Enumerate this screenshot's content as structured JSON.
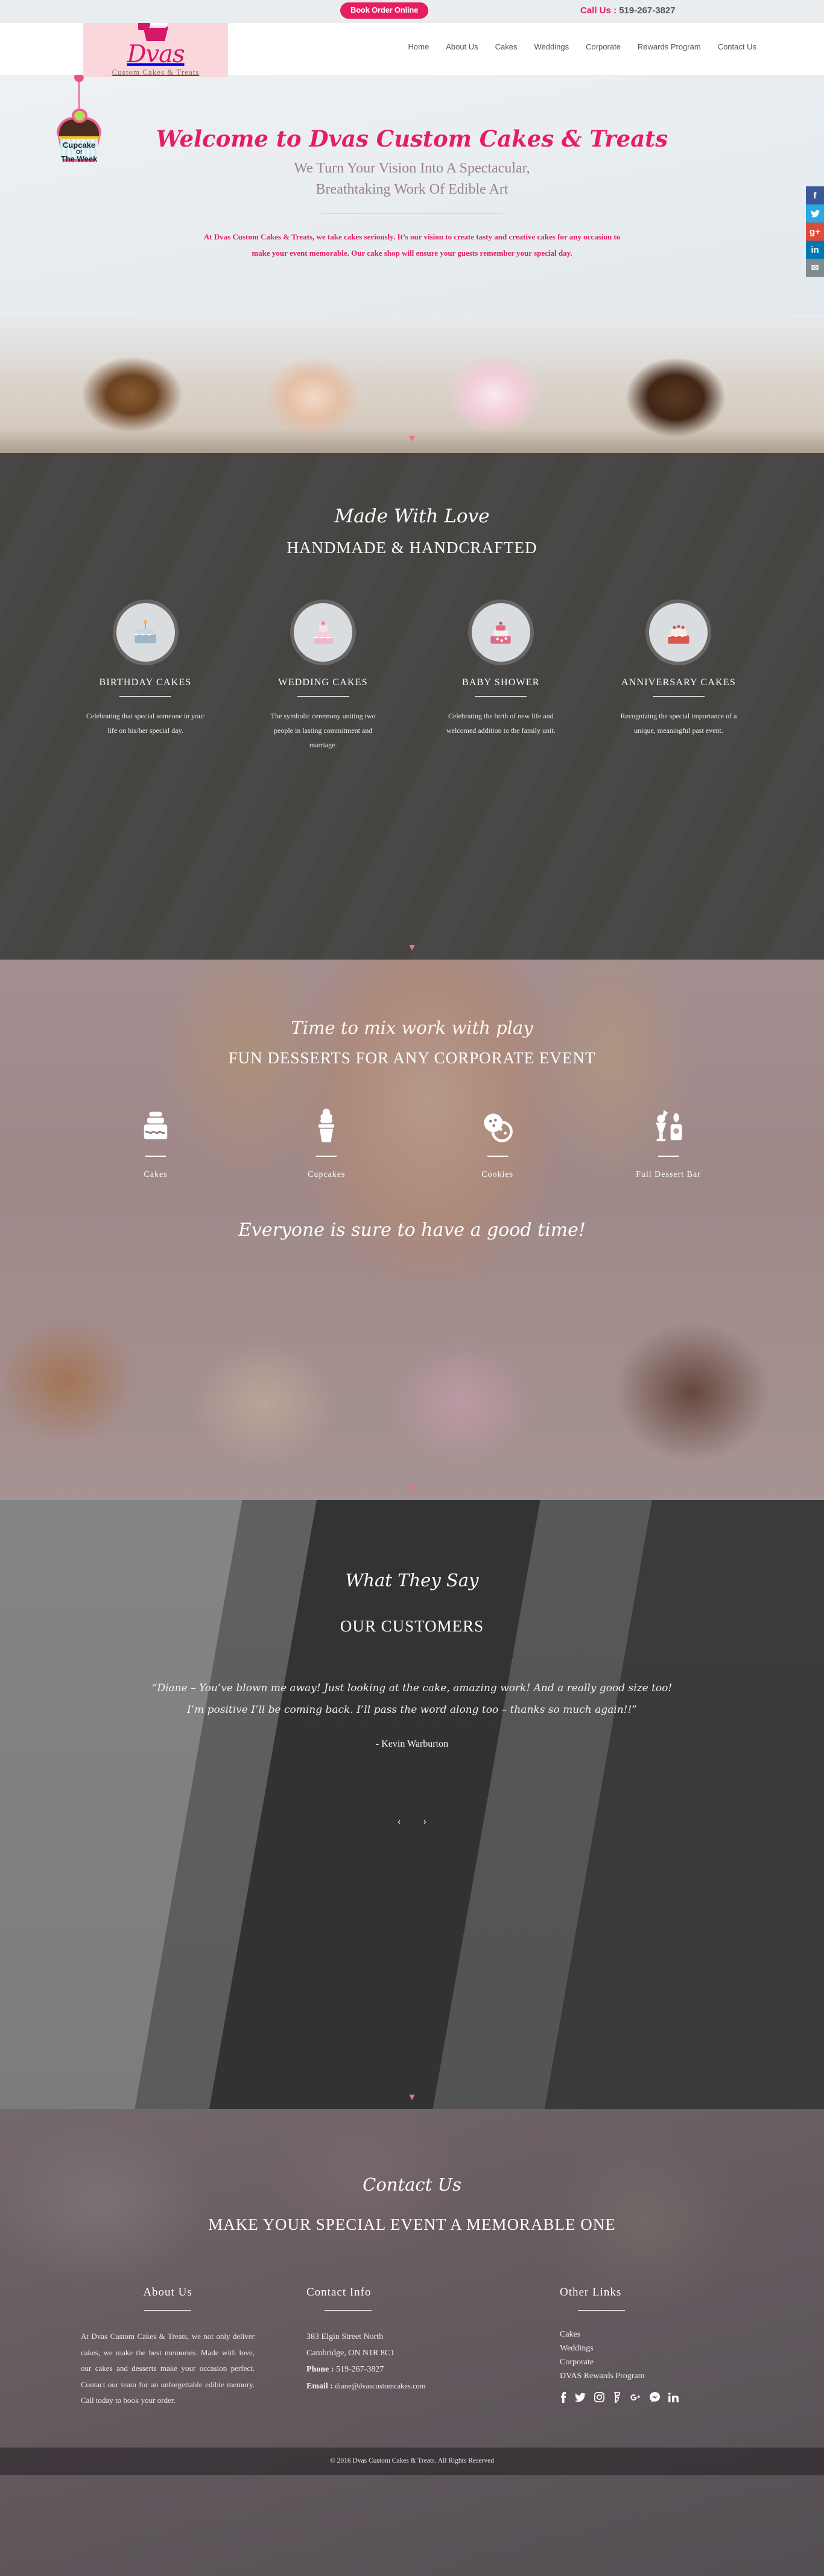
{
  "topbar": {
    "book_button": "Book Order Online",
    "call_label": "Call Us :",
    "phone": "519-267-3827"
  },
  "header": {
    "logo_name": "Dvas",
    "logo_sub": "Custom Cakes & Treats",
    "nav": [
      {
        "label": "Home"
      },
      {
        "label": "About Us"
      },
      {
        "label": "Cakes"
      },
      {
        "label": "Weddings"
      },
      {
        "label": "Corporate"
      },
      {
        "label": "Rewards Program"
      },
      {
        "label": "Contact Us"
      }
    ]
  },
  "badge": {
    "line1": "Cupcake",
    "line2": "Of",
    "line3": "The Week"
  },
  "social_rail": [
    {
      "name": "facebook",
      "glyph": "f"
    },
    {
      "name": "twitter",
      "glyph": "ᵗ"
    },
    {
      "name": "google-plus",
      "glyph": "g+"
    },
    {
      "name": "linkedin",
      "glyph": "in"
    },
    {
      "name": "email",
      "glyph": "✉"
    }
  ],
  "hero": {
    "title": "Welcome to Dvas Custom Cakes & Treats",
    "subtitle_line1": "We Turn Your Vision Into A Spectacular,",
    "subtitle_line2": "Breathtaking Work Of Edible Art",
    "paragraph": "At Dvas Custom Cakes & Treats, we take cakes seriously. It’s our vision to create tasty and creative cakes for any occasion to make your event memorable. Our cake shop will ensure your guests remember your special day."
  },
  "handmade": {
    "script_title": "Made With Love",
    "block_title": "HANDMADE & HANDCRAFTED",
    "cards": [
      {
        "icon": "birthday-cake-icon",
        "title": "BIRTHDAY CAKES",
        "text": "Celebrating that special someone in your life on his/her special day."
      },
      {
        "icon": "wedding-cake-icon",
        "title": "WEDDING CAKES",
        "text": "The symbolic ceremony uniting two people in lasting commitment and marriage."
      },
      {
        "icon": "baby-shower-cake-icon",
        "title": "BABY SHOWER",
        "text": "Celebrating the birth of new life and welcomed addition to the family unit."
      },
      {
        "icon": "anniversary-cake-icon",
        "title": "ANNIVERSARY CAKES",
        "text": "Recognizing the special importance of a unique, meaningful past event."
      }
    ]
  },
  "corporate": {
    "script_title": "Time to mix work with play",
    "block_title": "FUN DESSERTS FOR ANY CORPORATE EVENT",
    "items": [
      {
        "icon": "tiered-cake-icon",
        "label": "Cakes"
      },
      {
        "icon": "cupcake-icon",
        "label": "Cupcakes"
      },
      {
        "icon": "cookies-icon",
        "label": "Cookies"
      },
      {
        "icon": "dessert-bar-icon",
        "label": "Full Dessert Bar"
      }
    ],
    "tagline": "Everyone is sure to have a good time!"
  },
  "testimonial": {
    "script_title": "What They Say",
    "block_title": "OUR CUSTOMERS",
    "quote_line1": "“Diane – You’ve blown me away! Just looking at the cake, amazing work! And a really good size too!",
    "quote_line2": "I’m positive I’ll be coming back. I’ll pass the word along too – thanks so much again!!”",
    "author": "- Kevin Warburton",
    "prev": "‹",
    "next": "›"
  },
  "footer": {
    "script_title": "Contact Us",
    "block_title": "MAKE YOUR SPECIAL EVENT A MEMORABLE ONE",
    "about": {
      "heading": "About Us",
      "text": "At Dvas Custom Cakes & Treats, we not only deliver cakes, we make the best memories. Made with love, our cakes and desserts make your occasion perfect. Contact our team for an unforgettable edible memory. Call today to book your order."
    },
    "contact": {
      "heading": "Contact Info",
      "address_line1": "383 Elgin Street North",
      "address_line2": "Cambridge, ON N1R 8C1",
      "phone_label": "Phone :",
      "phone": "519-267-3827",
      "email_label": "Email :",
      "email": "diane@dvascustomcakes.com"
    },
    "links": {
      "heading": "Other Links",
      "items": [
        {
          "label": "Cakes"
        },
        {
          "label": "Weddings"
        },
        {
          "label": "Corporate"
        },
        {
          "label": "DVAS Rewards Program"
        }
      ],
      "social": [
        {
          "name": "facebook",
          "glyph": "f"
        },
        {
          "name": "twitter",
          "glyph": "t"
        },
        {
          "name": "instagram",
          "glyph": "ig"
        },
        {
          "name": "foursquare",
          "glyph": "fs"
        },
        {
          "name": "google-plus",
          "glyph": "g+"
        },
        {
          "name": "messenger",
          "glyph": "ms"
        },
        {
          "name": "linkedin",
          "glyph": "in"
        }
      ]
    },
    "copyright": "© 2016 Dvas Custom Cakes & Treats. All Rights Reserved"
  },
  "colors": {
    "brand_pink": "#e71d62",
    "logo_bg": "#f9d7da",
    "topbar_bg": "#e9edf0"
  }
}
